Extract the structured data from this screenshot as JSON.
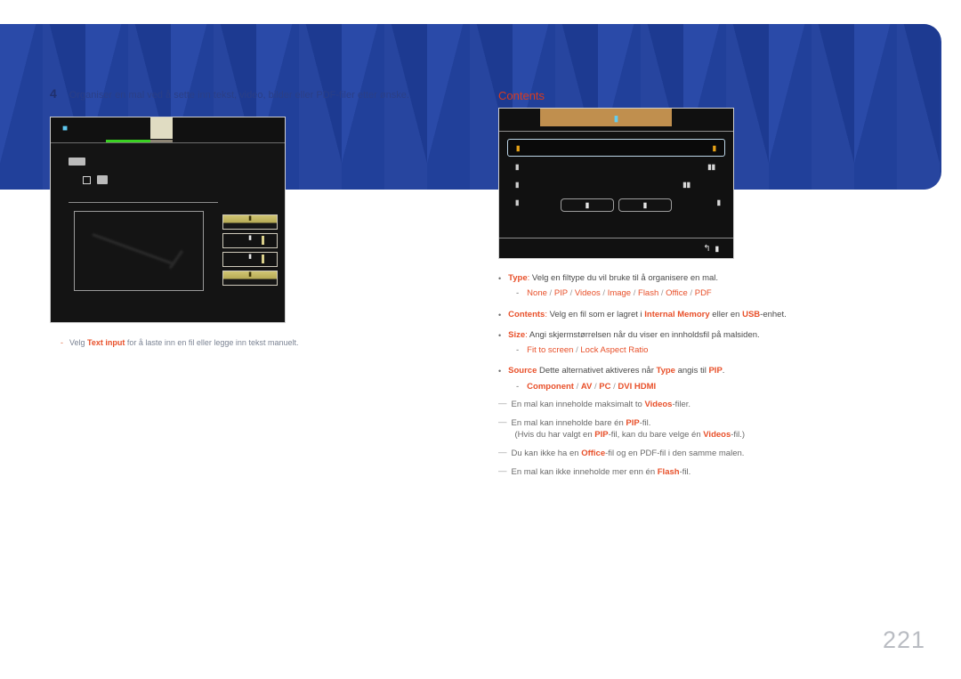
{
  "page": {
    "number": "221"
  },
  "step": {
    "number": "4",
    "text": "Organiser en mal ved å sette inn tekst, video, bilder eller PDF-filer etter ønske."
  },
  "contents_heading": "Contents",
  "left_screenshot": {
    "topbar_icon": "template-icon",
    "glyph_a": "label-glyph",
    "checkbox": "checkbox-unchecked",
    "glyph_b": "option-glyph",
    "buttons": [
      {
        "label": "▮",
        "highlighted": true
      },
      {
        "label": "▮",
        "highlighted": false
      },
      {
        "label": "▮",
        "highlighted": false
      },
      {
        "label": "▮",
        "highlighted": true
      }
    ],
    "caption": {
      "dash": "-",
      "pre": "Velg ",
      "highlight": "Text input",
      "post": " for å laste inn en fil eller legge inn tekst manuelt."
    }
  },
  "right_mockup": {
    "title": "▮",
    "rows": [
      {
        "key": "▮",
        "value": "▮",
        "selected": true
      },
      {
        "key": "▮",
        "value": "▮▮",
        "selected": false
      },
      {
        "key": "▮",
        "value": "▮▮",
        "selected": false
      },
      {
        "key": "▮",
        "value": "▮",
        "selected": false
      }
    ],
    "buttons": [
      {
        "label": "▮"
      },
      {
        "label": "▮"
      }
    ],
    "footer": {
      "return_icon": "return-arrow-icon",
      "return_label": "▮"
    }
  },
  "options": [
    {
      "term": "Type",
      "separator": ":",
      "description": " Velg en filtype du vil bruke til å organisere en mal.",
      "values": [
        "None",
        "PIP",
        "Videos",
        "Image",
        "Flash",
        "Office",
        "PDF"
      ]
    },
    {
      "term": "Contents",
      "separator": ":",
      "description_parts": [
        {
          "text": " Velg en fil som er lagret i ",
          "highlight": false
        },
        {
          "text": "Internal Memory",
          "highlight": true
        },
        {
          "text": " eller en ",
          "highlight": false
        },
        {
          "text": "USB",
          "highlight": true
        },
        {
          "text": "-enhet.",
          "highlight": false
        }
      ]
    },
    {
      "term": "Size",
      "separator": ":",
      "description": " Angi skjermstørrelsen når du viser en innholdsfil på malsiden.",
      "values": [
        "Fit to screen",
        "Lock Aspect Ratio"
      ]
    },
    {
      "term": "Source",
      "separator": "",
      "description_parts": [
        {
          "text": " Dette alternativet aktiveres når ",
          "highlight": false
        },
        {
          "text": "Type",
          "highlight": true
        },
        {
          "text": " angis til ",
          "highlight": false
        },
        {
          "text": "PIP",
          "highlight": true
        },
        {
          "text": ".",
          "highlight": false
        }
      ],
      "values": [
        "Component",
        "AV",
        "PC",
        "DVI",
        "HDMI"
      ]
    }
  ],
  "notes": [
    {
      "parts": [
        {
          "text": "En mal kan inneholde maksimalt to ",
          "highlight": false
        },
        {
          "text": "Videos",
          "highlight": true
        },
        {
          "text": "-filer.",
          "highlight": false
        }
      ]
    },
    {
      "parts": [
        {
          "text": "En mal kan inneholde bare én ",
          "highlight": false
        },
        {
          "text": "PIP",
          "highlight": true
        },
        {
          "text": "-fil.",
          "highlight": false
        }
      ],
      "sub_parts": [
        {
          "text": "(Hvis du har valgt en ",
          "highlight": false
        },
        {
          "text": "PIP",
          "highlight": true
        },
        {
          "text": "-fil, kan du bare velge én ",
          "highlight": false
        },
        {
          "text": "Videos",
          "highlight": true
        },
        {
          "text": "-fil.)",
          "highlight": false
        }
      ]
    },
    {
      "parts": [
        {
          "text": "Du kan ikke ha en ",
          "highlight": false
        },
        {
          "text": "Office",
          "highlight": true
        },
        {
          "text": "-fil og en PDF-fil i den samme malen.",
          "highlight": false
        }
      ]
    },
    {
      "parts": [
        {
          "text": "En mal kan ikke inneholde mer enn én ",
          "highlight": false
        },
        {
          "text": "Flash",
          "highlight": true
        },
        {
          "text": "-fil.",
          "highlight": false
        }
      ]
    }
  ],
  "colors": {
    "banner_blue": "#213f98",
    "accent_red": "#e8502a",
    "heading_red": "#d83a1e",
    "gold": "#c08f4e",
    "cyan": "#63cdf0",
    "amber": "#e8a317",
    "green": "#3ad122"
  }
}
